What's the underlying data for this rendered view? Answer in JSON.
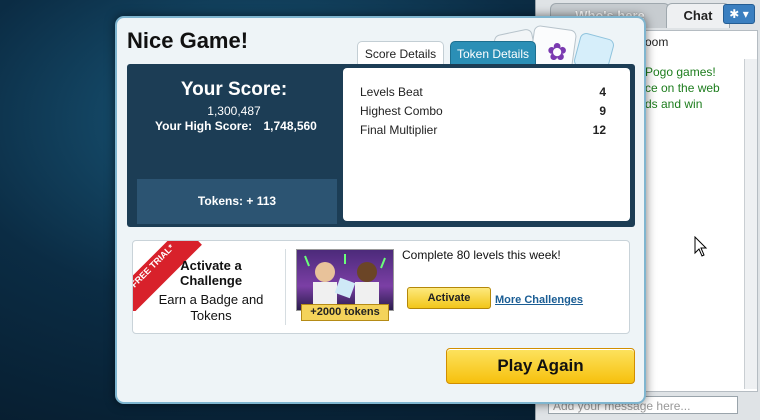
{
  "chat": {
    "tab_whos_here": "Who's here",
    "tab_chat": "Chat",
    "gear_label": "✱",
    "room_label": "oom",
    "message_lines": [
      "Pogo games!",
      "ce on the web",
      "ds and win"
    ],
    "input_placeholder": "Add your message here..."
  },
  "modal": {
    "title": "Nice Game!",
    "tabs": {
      "score_details": "Score Details",
      "token_details": "Token Details"
    },
    "score": {
      "heading": "Your Score:",
      "value": "1,300,487",
      "high_label": "Your High Score:",
      "high_value": "1,748,560",
      "tokens": "Tokens: + 113"
    },
    "details": [
      {
        "label": "Levels Beat",
        "value": "4"
      },
      {
        "label": "Highest Combo",
        "value": "9"
      },
      {
        "label": "Final Multiplier",
        "value": "12"
      }
    ],
    "challenge": {
      "ribbon": "FREE TRIAL*",
      "heading": "Activate a Challenge",
      "subtext": "Earn a Badge and Tokens",
      "badge": "+2000 tokens",
      "description": "Complete 80 levels this week!",
      "activate_label": "Activate",
      "more_label": "More Challenges"
    },
    "play_again_label": "Play Again"
  },
  "colors": {
    "accent_blue": "#2b8fb6",
    "panel_navy": "#1c3d55",
    "button_yellow": "#f6c00d",
    "chat_green": "#1d7d1d",
    "ribbon_red": "#d8212b"
  }
}
